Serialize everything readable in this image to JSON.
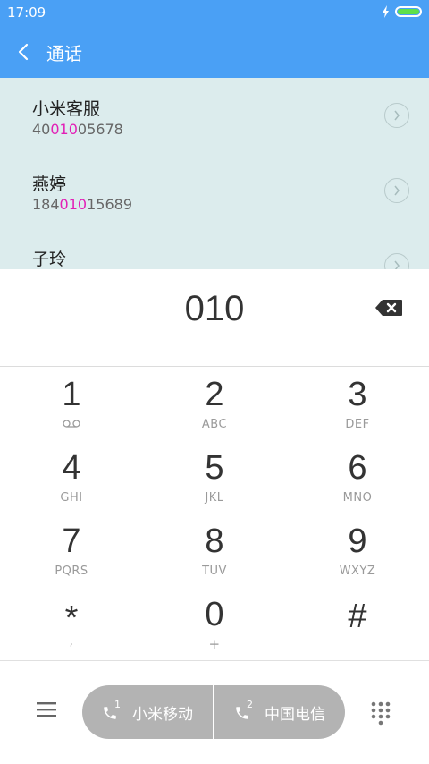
{
  "status": {
    "time": "17:09"
  },
  "header": {
    "title": "通话"
  },
  "results": [
    {
      "name": "小米客服",
      "num_pre": "40",
      "num_hl": "010",
      "num_post": "05678"
    },
    {
      "name": "燕婷",
      "num_pre": "184",
      "num_hl": "010",
      "num_post": "15689"
    },
    {
      "name": "子玲",
      "num_pre": "",
      "num_hl": "",
      "num_post": ""
    }
  ],
  "dial": {
    "input": "010"
  },
  "keys": [
    {
      "digit": "1",
      "letters": ""
    },
    {
      "digit": "2",
      "letters": "ABC"
    },
    {
      "digit": "3",
      "letters": "DEF"
    },
    {
      "digit": "4",
      "letters": "GHI"
    },
    {
      "digit": "5",
      "letters": "JKL"
    },
    {
      "digit": "6",
      "letters": "MNO"
    },
    {
      "digit": "7",
      "letters": "PQRS"
    },
    {
      "digit": "8",
      "letters": "TUV"
    },
    {
      "digit": "9",
      "letters": "WXYZ"
    },
    {
      "digit": "*",
      "letters": ","
    },
    {
      "digit": "0",
      "letters": "+"
    },
    {
      "digit": "#",
      "letters": ""
    }
  ],
  "sim": {
    "sim1_label": "小米移动",
    "sim1_index": "1",
    "sim2_label": "中国电信",
    "sim2_index": "2"
  },
  "colors": {
    "header": "#4aa0f5",
    "highlight": "#e21fb6",
    "results_bg": "#dceced",
    "sim_button": "#b3b3b3"
  }
}
